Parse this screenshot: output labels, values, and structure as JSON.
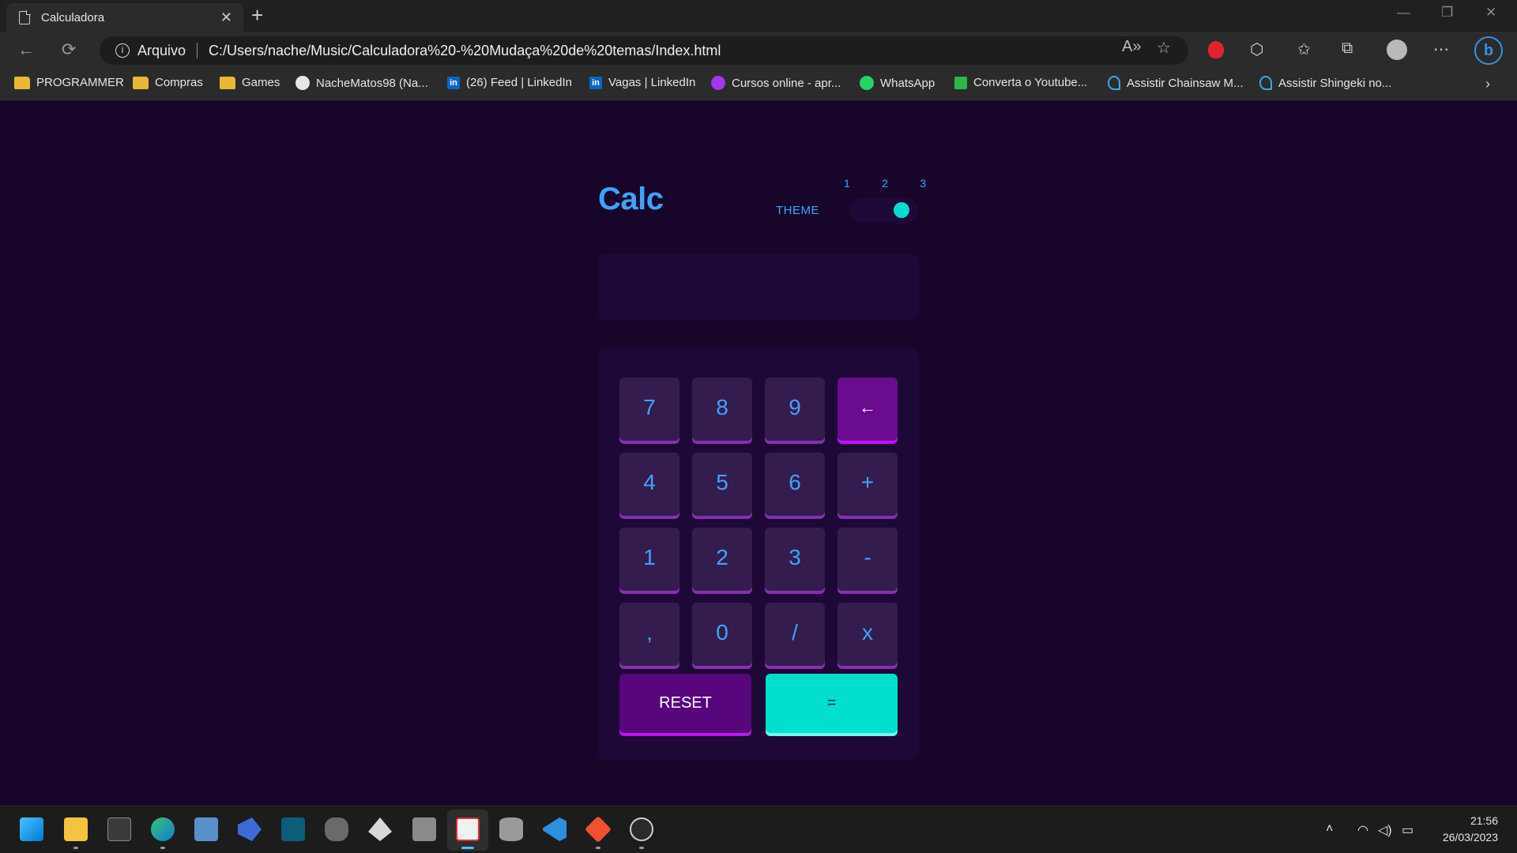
{
  "browser": {
    "tab_title": "Calculadora",
    "tab_close": "✕",
    "new_tab": "+",
    "site_label": "Arquivo",
    "url": "C:/Users/nache/Music/Calculadora%20-%20Mudaça%20de%20temas/Index.html",
    "window_controls": {
      "minimize": "—",
      "restore": "❐",
      "close": "✕"
    },
    "icons": {
      "back": "arrow-left-icon",
      "refresh": "refresh-icon",
      "read_aloud": "read-aloud-icon",
      "add_favorite": "add-favorite-icon",
      "adblock": "adblock-icon",
      "extensions": "puzzle-icon",
      "favorites": "favorites-icon",
      "collections": "collections-icon",
      "profile": "profile-icon",
      "more": "more-icon",
      "bing": "bing-icon"
    }
  },
  "bookmarks": [
    {
      "label": "PROGRAMMER",
      "icon": "folder"
    },
    {
      "label": "Compras",
      "icon": "folder"
    },
    {
      "label": "Games",
      "icon": "folder"
    },
    {
      "label": "NacheMatos98 (Na...",
      "icon": "github"
    },
    {
      "label": "(26) Feed | LinkedIn",
      "icon": "linkedin"
    },
    {
      "label": "Vagas | LinkedIn",
      "icon": "linkedin"
    },
    {
      "label": "Cursos online - apr...",
      "icon": "udemy"
    },
    {
      "label": "WhatsApp",
      "icon": "whatsapp"
    },
    {
      "label": "Converta o Youtube...",
      "icon": "download"
    },
    {
      "label": "Assistir Chainsaw M...",
      "icon": "anime"
    },
    {
      "label": "Assistir Shingeki no...",
      "icon": "anime"
    }
  ],
  "calculator": {
    "title": "Calc",
    "theme_label": "THEME",
    "theme_options": [
      "1",
      "2",
      "3"
    ],
    "theme_selected": 3,
    "display_value": "",
    "keys": [
      "7",
      "8",
      "9",
      "←",
      "4",
      "5",
      "6",
      "+",
      "1",
      "2",
      "3",
      "-",
      ",",
      "0",
      "/",
      "x"
    ],
    "reset_label": "RESET",
    "equals_label": "=",
    "colors": {
      "background": "#17062a",
      "panel": "#1e0837",
      "key": "#341c4f",
      "key_text": "#3fa3ff",
      "accent": "#00dece",
      "fn_key": "#6b0b8f"
    }
  },
  "taskbar": {
    "apps": [
      "windows-start-icon",
      "file-explorer-icon",
      "terminal-icon",
      "edge-icon",
      "monitor-icon",
      "azure-data-studio-icon",
      "intellij-icon",
      "game-icon",
      "inkscape-icon",
      "calculator-icon",
      "snipping-tool-icon",
      "database-icon",
      "vscode-icon",
      "git-icon",
      "obs-icon"
    ],
    "time": "21:56",
    "date": "26/03/2023"
  }
}
